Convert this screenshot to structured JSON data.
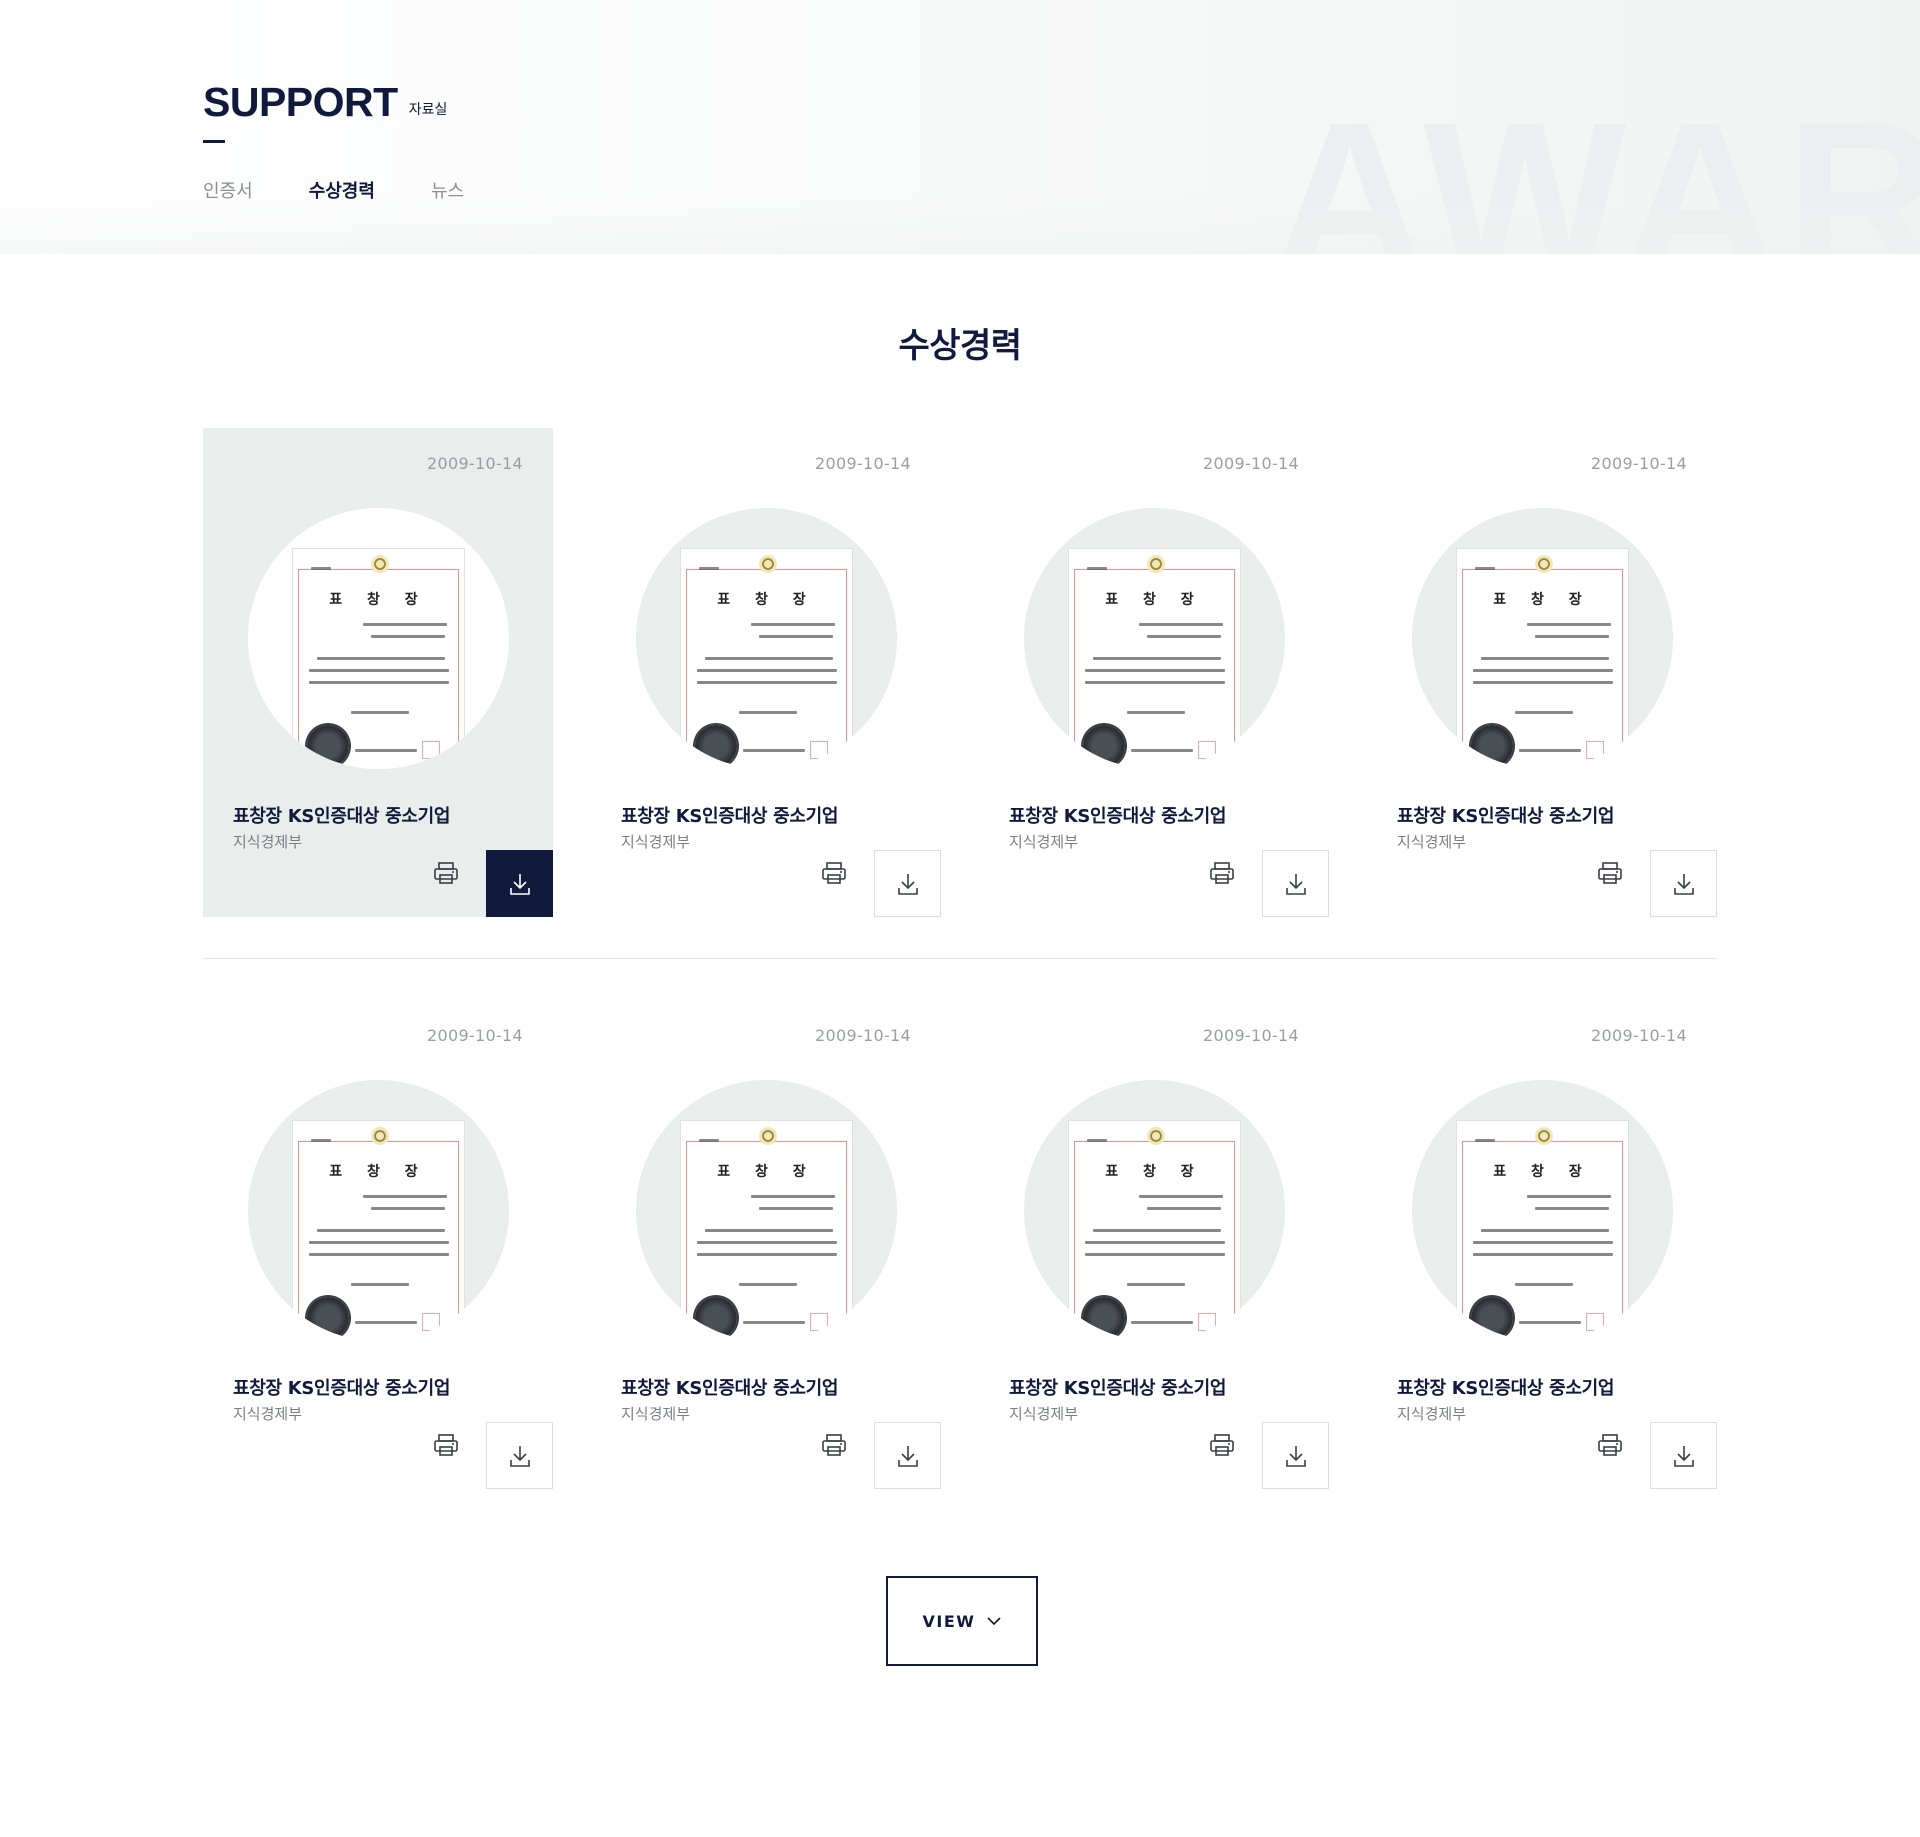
{
  "header": {
    "title": "SUPPORT",
    "subtitle": "자료실",
    "background_word": "AWARD",
    "tabs": [
      {
        "label": "인증서",
        "active": false
      },
      {
        "label": "수상경력",
        "active": true
      },
      {
        "label": "뉴스",
        "active": false
      }
    ]
  },
  "section": {
    "title": "수상경력"
  },
  "cards": [
    {
      "date": "2009-10-14",
      "title": "표창장 KS인증대상 중소기업",
      "org": "지식경제부",
      "active": true
    },
    {
      "date": "2009-10-14",
      "title": "표창장 KS인증대상 중소기업",
      "org": "지식경제부",
      "active": false
    },
    {
      "date": "2009-10-14",
      "title": "표창장 KS인증대상 중소기업",
      "org": "지식경제부",
      "active": false
    },
    {
      "date": "2009-10-14",
      "title": "표창장 KS인증대상 중소기업",
      "org": "지식경제부",
      "active": false
    },
    {
      "date": "2009-10-14",
      "title": "표창장 KS인증대상 중소기업",
      "org": "지식경제부",
      "active": false
    },
    {
      "date": "2009-10-14",
      "title": "표창장 KS인증대상 중소기업",
      "org": "지식경제부",
      "active": false
    },
    {
      "date": "2009-10-14",
      "title": "표창장 KS인증대상 중소기업",
      "org": "지식경제부",
      "active": false
    },
    {
      "date": "2009-10-14",
      "title": "표창장 KS인증대상 중소기업",
      "org": "지식경제부",
      "active": false
    }
  ],
  "certificate": {
    "heading": "표 창 장"
  },
  "icons": {
    "print": "printer-icon",
    "download": "download-icon",
    "view_arrow": "chevron-down-icon"
  },
  "view_button": {
    "label": "VIEW"
  },
  "colors": {
    "navy": "#0f1a3c",
    "card_active_bg": "#e9edec",
    "muted_text": "#9a9ea3"
  }
}
